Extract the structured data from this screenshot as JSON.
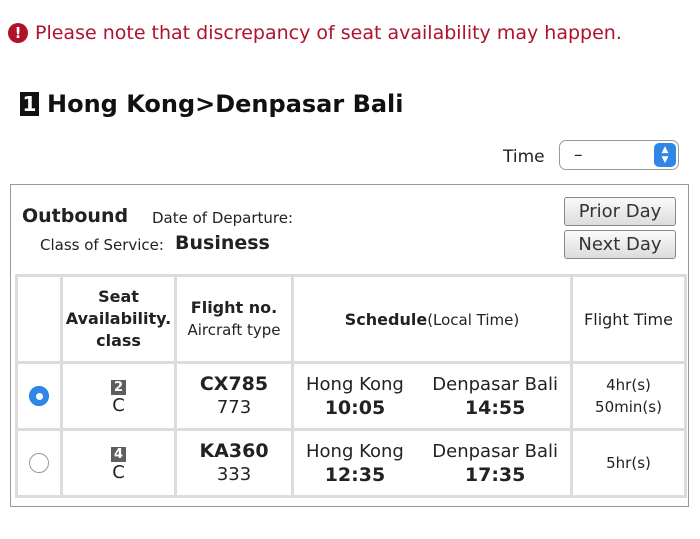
{
  "notice": {
    "icon": "exclamation-icon",
    "text": "Please note that discrepancy of seat availability may happen."
  },
  "route": {
    "number": "1",
    "title": "Hong Kong>Denpasar Bali"
  },
  "time_filter": {
    "label": "Time",
    "selected": "–"
  },
  "panel": {
    "direction": "Outbound",
    "date_label": "Date of Departure:",
    "class_label": "Class of Service:",
    "class_value": "Business",
    "prior_day": "Prior Day",
    "next_day": "Next Day"
  },
  "table": {
    "headers": {
      "seat_line1": "Seat",
      "seat_line2": "Availability.",
      "seat_line3": "class",
      "flight_line1": "Flight no.",
      "flight_line2": "Aircraft type",
      "schedule_bold": "Schedule",
      "schedule_note": "(Local Time)",
      "flight_time": "Flight Time"
    },
    "rows": [
      {
        "selected": true,
        "seats": "2",
        "class": "C",
        "flight_no": "CX785",
        "aircraft": "773",
        "dep_city": "Hong Kong",
        "dep_time": "10:05",
        "arr_city": "Denpasar Bali",
        "arr_time": "14:55",
        "duration_line1": "4hr(s)",
        "duration_line2": "50min(s)"
      },
      {
        "selected": false,
        "seats": "4",
        "class": "C",
        "flight_no": "KA360",
        "aircraft": "333",
        "dep_city": "Hong Kong",
        "dep_time": "12:35",
        "arr_city": "Denpasar Bali",
        "arr_time": "17:35",
        "duration_line1": "5hr(s)",
        "duration_line2": ""
      }
    ]
  },
  "colors": {
    "notice_red": "#b0122a",
    "select_blue": "#2f87ea",
    "border_gray": "#dcdcdc"
  }
}
